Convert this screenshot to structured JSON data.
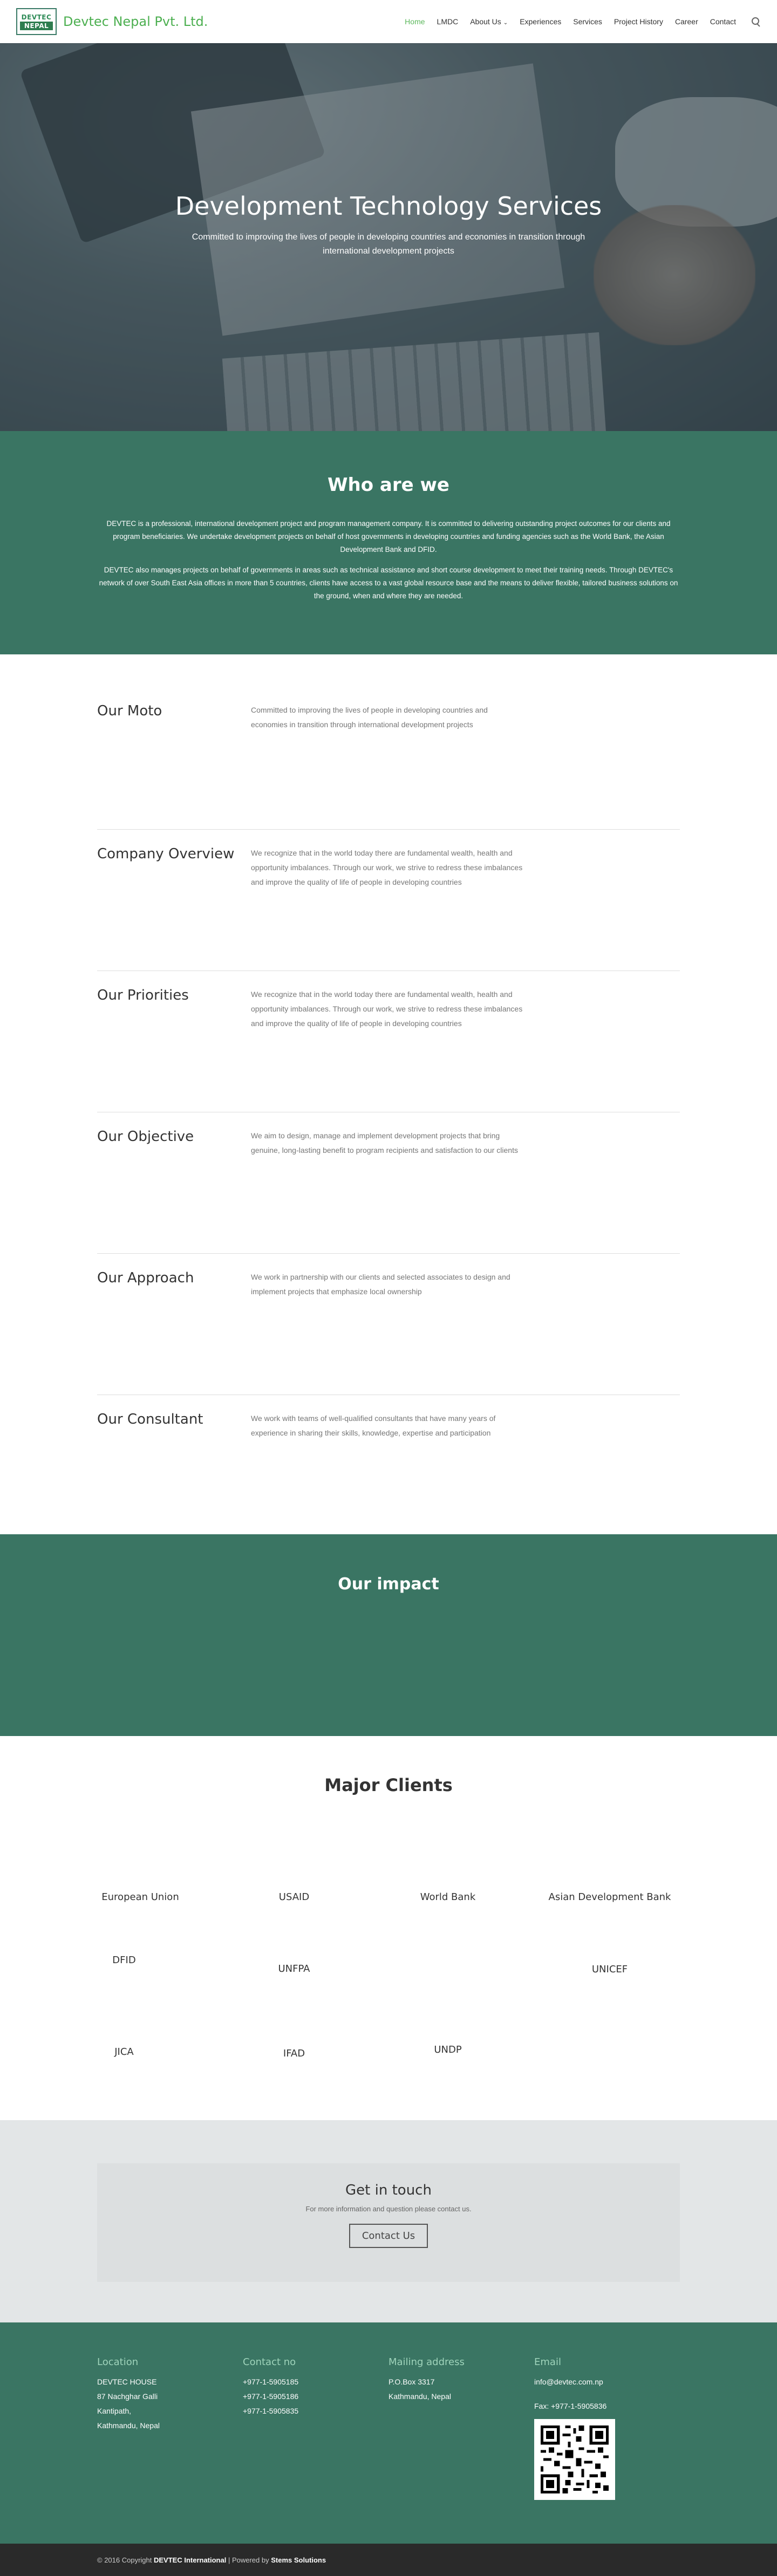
{
  "header": {
    "logo_line1": "DEVTEC",
    "logo_line2": "NEPAL",
    "brand": "Devtec Nepal Pvt. Ltd.",
    "nav": [
      "Home",
      "LMDC",
      "About Us",
      "Experiences",
      "Services",
      "Project History",
      "Career",
      "Contact"
    ]
  },
  "hero": {
    "title": "Development Technology Services",
    "subtitle": "Committed to improving the lives of people in developing countries and economies in transition through international development projects"
  },
  "who": {
    "title": "Who are we",
    "p1": "DEVTEC is a professional, international development project and program management company. It is committed to delivering outstanding project outcomes for our clients and program beneficiaries. We undertake development projects on behalf of host governments in developing countries and funding agencies such as the World Bank, the Asian Development Bank and DFID.",
    "p2": "DEVTEC also manages projects on behalf of governments in areas such as technical assistance and short course development to meet their training needs. Through DEVTEC's network of over South East Asia offices in more than 5 countries, clients have access to a vast global resource base and the means to deliver flexible, tailored business solutions on the ground, when and where they are needed."
  },
  "rows": [
    {
      "title": "Our Moto",
      "text": "Committed to improving the lives of people in developing countries and economies in transition through international development projects"
    },
    {
      "title": "Company Overview",
      "text": "We recognize that in the world today there are fundamental wealth, health and opportunity imbalances. Through our work, we strive to redress these imbalances and improve the quality of life of people in developing countries"
    },
    {
      "title": "Our Priorities",
      "text": "We recognize that in the world today there are fundamental wealth, health and opportunity imbalances. Through our work, we strive to redress these imbalances and improve the quality of life of people in developing countries"
    },
    {
      "title": "Our Objective",
      "text": "We aim to design, manage and implement development projects that bring genuine, long-lasting benefit to program recipients and satisfaction to our clients"
    },
    {
      "title": "Our Approach",
      "text": "We work in partnership with our clients and selected associates to design and implement projects that emphasize local ownership"
    },
    {
      "title": "Our Consultant",
      "text": "We work with teams of well-qualified consultants that have many years of experience in sharing their skills, knowledge, expertise and participation"
    }
  ],
  "impact": {
    "title": "Our impact"
  },
  "clients": {
    "title": "Major Clients",
    "items": [
      "European Union",
      "USAID",
      "World Bank",
      "Asian Development Bank",
      "DFID",
      "UNFPA",
      "UNICEF",
      "JICA",
      "IFAD",
      "UNDP"
    ]
  },
  "get_in_touch": {
    "title": "Get in touch",
    "text": "For more information and question please contact us.",
    "button": "Contact Us"
  },
  "footer": {
    "location": {
      "title": "Location",
      "lines": [
        "DEVTEC HOUSE",
        "87 Nachghar Galli",
        "Kantipath,",
        "Kathmandu, Nepal"
      ]
    },
    "contact": {
      "title": "Contact no",
      "lines": [
        "+977-1-5905185",
        "+977-1-5905186",
        "+977-1-5905835"
      ]
    },
    "mailing": {
      "title": "Mailing address",
      "lines": [
        "P.O.Box 3317",
        "Kathmandu, Nepal"
      ]
    },
    "email": {
      "title": "Email",
      "address": "info@devtec.com.np",
      "fax": "Fax: +977-1-5905836"
    },
    "copyright_prefix": "© 2016 Copyright",
    "company": "DEVTEC International",
    "powered_prefix": "| Powered by",
    "powered_by": "Stems Solutions"
  }
}
